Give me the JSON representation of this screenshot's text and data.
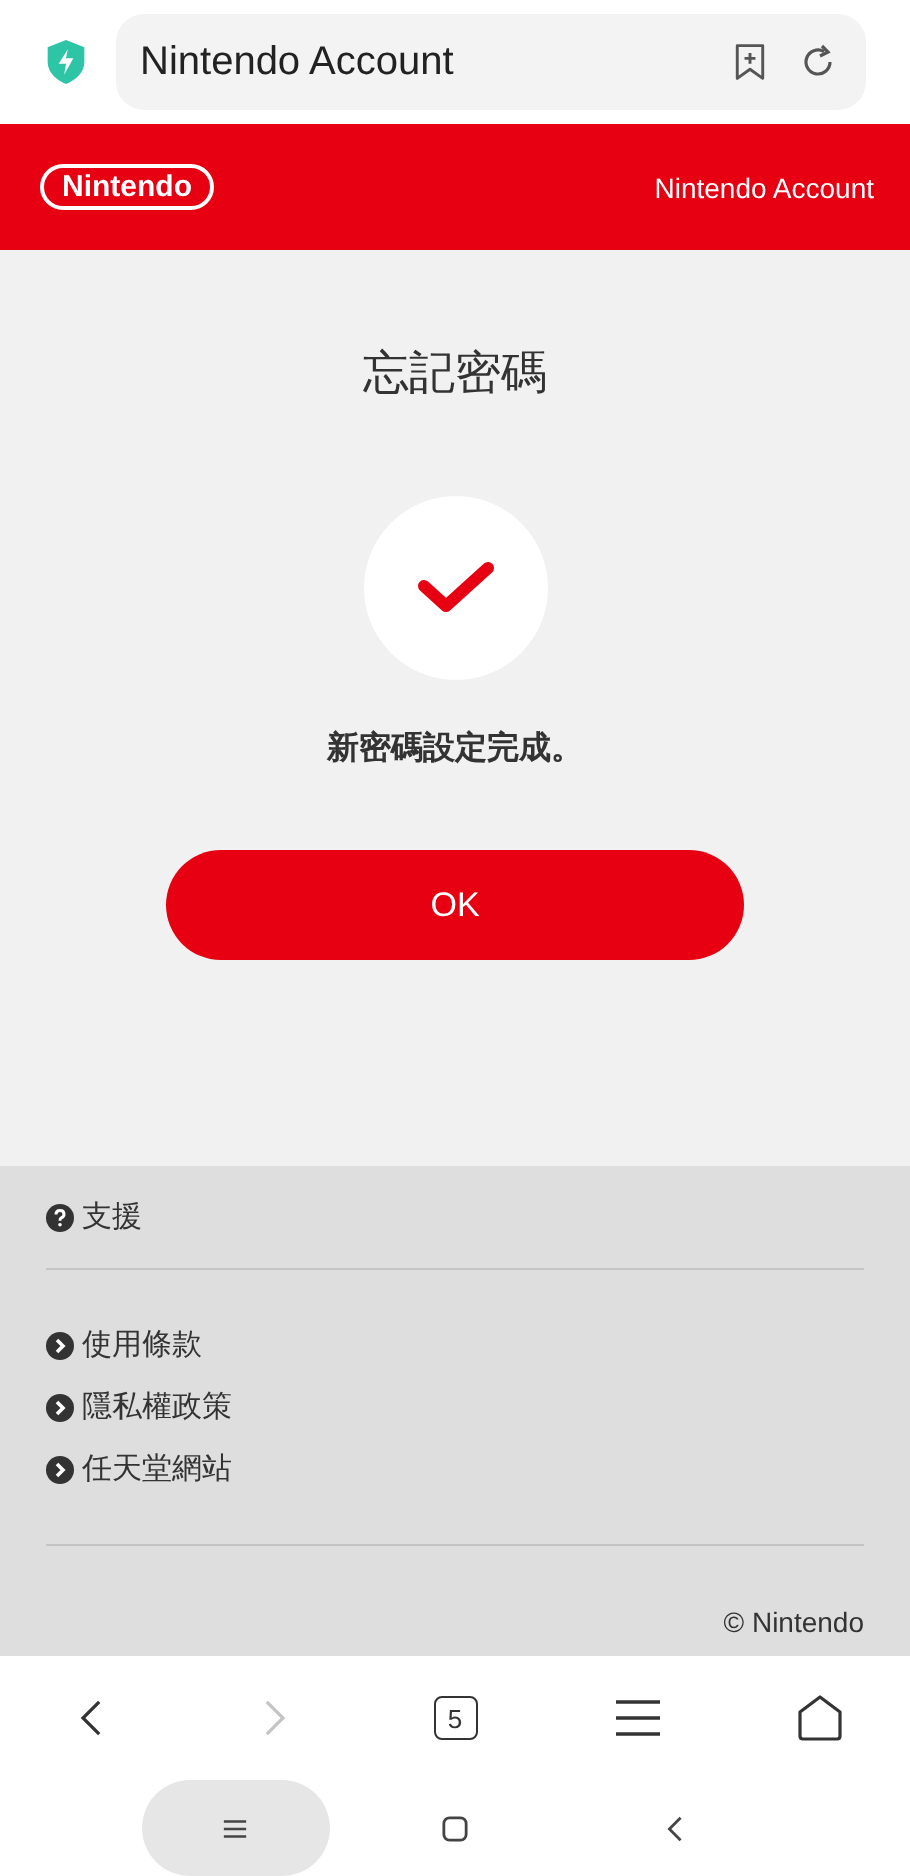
{
  "address_bar": {
    "title": "Nintendo Account"
  },
  "header": {
    "logo": "Nintendo",
    "title": "Nintendo Account"
  },
  "main": {
    "heading": "忘記密碼",
    "message": "新密碼設定完成。",
    "button": "OK"
  },
  "footer": {
    "support": [
      {
        "label": "支援"
      }
    ],
    "links": [
      {
        "label": "使用條款"
      },
      {
        "label": "隱私權政策"
      },
      {
        "label": "任天堂網站"
      }
    ],
    "copyright": "© Nintendo"
  },
  "browser_nav": [
    {
      "kind": "back",
      "disabled": false
    },
    {
      "kind": "forward",
      "disabled": true
    },
    {
      "kind": "tabs",
      "label": "5",
      "disabled": false
    },
    {
      "kind": "menu",
      "disabled": false
    },
    {
      "kind": "home",
      "disabled": false
    }
  ],
  "system_nav": [
    {
      "kind": "recents",
      "selected": true
    },
    {
      "kind": "home",
      "selected": false
    },
    {
      "kind": "back",
      "selected": false
    }
  ]
}
